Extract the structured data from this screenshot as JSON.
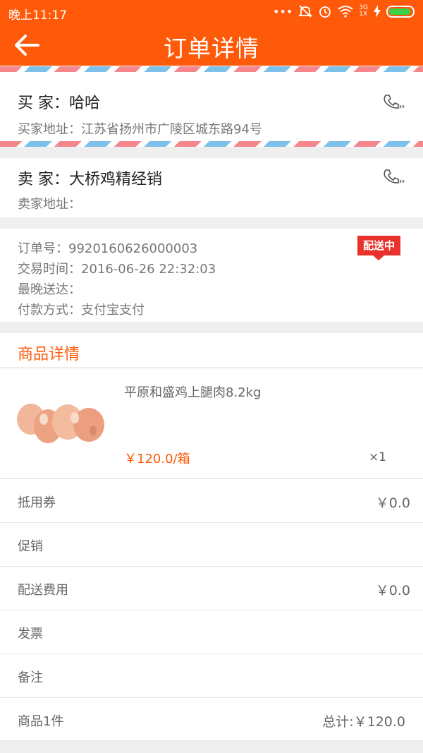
{
  "status_bar": {
    "time": "晚上11:17",
    "network_top": "3G",
    "network_bottom": "1X"
  },
  "header": {
    "title": "订单详情"
  },
  "buyer": {
    "label": "买 家：",
    "name": "哈哈",
    "address_label": "买家地址：",
    "address": "江苏省扬州市广陵区城东路94号"
  },
  "seller": {
    "label": "卖 家：",
    "name": "大桥鸡精经销",
    "address_label": "卖家地址：",
    "address": ""
  },
  "order": {
    "number_label": "订单号：",
    "number": "9920160626000003",
    "time_label": "交易时间：",
    "time": "2016-06-26 22:32:03",
    "latest_label": "最晚送达：",
    "latest": "",
    "payment_label": "付款方式：",
    "payment": "支付宝支付",
    "status_badge": "配送中"
  },
  "goods": {
    "section_title": "商品详情",
    "items": [
      {
        "name": "平原和盛鸡上腿肉8.2kg",
        "price": "￥120.0/箱",
        "qty": "×1"
      }
    ]
  },
  "summary": {
    "voucher_label": "抵用券",
    "voucher_value": "￥0.0",
    "promo_label": "促销",
    "delivery_label": "配送费用",
    "delivery_value": "￥0.0",
    "invoice_label": "发票",
    "remark_label": "备注",
    "count_label": "商品1件",
    "total": "总计:￥120.0"
  },
  "colors": {
    "accent": "#ff5a0a",
    "badge": "#e8322b",
    "mail_red": "#f4868c",
    "mail_blue": "#7dc0ea"
  }
}
